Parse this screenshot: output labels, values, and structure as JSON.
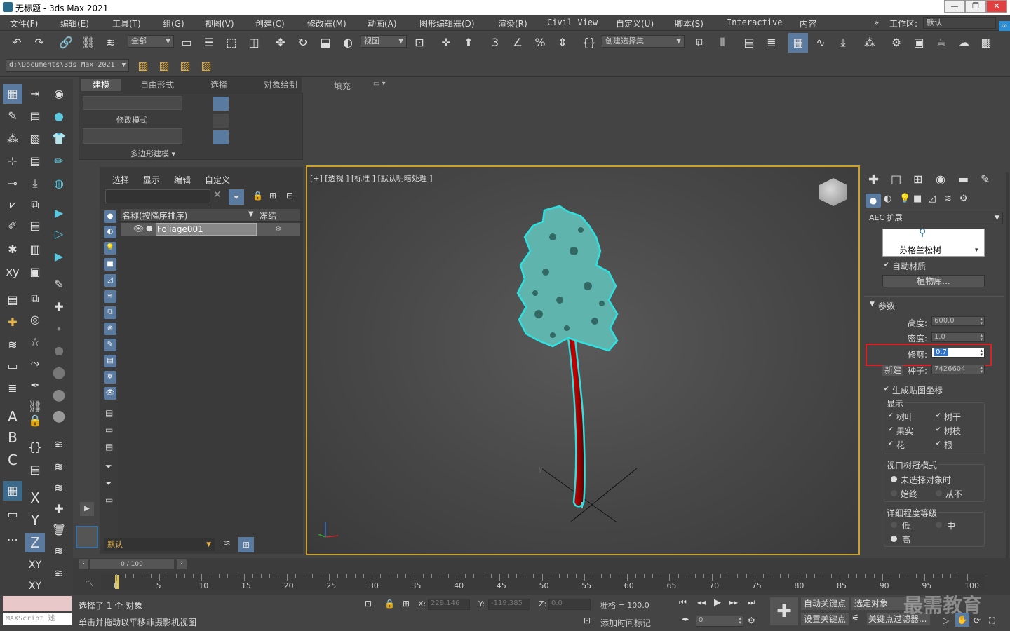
{
  "window": {
    "title": "无标题 - 3ds Max 2021",
    "controls": [
      "—",
      "❐",
      "✕"
    ]
  },
  "menu": [
    "文件(F)",
    "编辑(E)",
    "工具(T)",
    "组(G)",
    "视图(V)",
    "创建(C)",
    "修改器(M)",
    "动画(A)",
    "图形编辑器(D)",
    "渲染(R)",
    "Civil View",
    "自定义(U)",
    "脚本(S)",
    "Interactive",
    "内容"
  ],
  "workspace": {
    "label": "工作区:",
    "value": "默认"
  },
  "toolbar": {
    "selection_filter": "全部",
    "ref_coord": "视图",
    "named_sel": "创建选择集",
    "path": "d:\\Documents\\3ds Max 2021"
  },
  "ribbon": {
    "tabs": [
      "建模",
      "自由形式",
      "选择",
      "对象绘制",
      "填充"
    ],
    "modify_mode": "修改模式",
    "poly_modeling": "多边形建模 ▾"
  },
  "scene_explorer": {
    "menu": [
      "选择",
      "显示",
      "编辑",
      "自定义"
    ],
    "col_name": "名称(按降序排序)",
    "col_freeze": "冻结",
    "row": "Foliage001",
    "layer": "默认",
    "scroll": "0 / 100"
  },
  "viewport": {
    "label": "[+] [透视 ] [标准 ] [默认明暗处理 ]"
  },
  "command_panel": {
    "category": "AEC 扩展",
    "plant_name": "苏格兰松树",
    "auto_material": "自动材质",
    "plant_library": "植物库...",
    "params_title": "参数",
    "height_label": "高度:",
    "height": "600.0",
    "density_label": "密度:",
    "density": "1.0",
    "prune_label": "修剪:",
    "prune": "0.7",
    "new_label": "新建",
    "seed_label": "种子:",
    "seed": "7426604",
    "gen_map": "生成贴图坐标",
    "display_title": "显示",
    "leaves": "树叶",
    "trunk": "树干",
    "fruit": "果实",
    "branches": "树枝",
    "flowers": "花",
    "roots": "根",
    "canopy_title": "视口树冠模式",
    "canopy_unselected": "未选择对象时",
    "canopy_always": "始终",
    "canopy_never": "从不",
    "lod_title": "详细程度等级",
    "lod_low": "低",
    "lod_med": "中",
    "lod_high": "高"
  },
  "timeline": {
    "ticks": [
      "0",
      "5",
      "10",
      "15",
      "20",
      "25",
      "30",
      "35",
      "40",
      "45",
      "50",
      "55",
      "60",
      "65",
      "70",
      "75",
      "80",
      "85",
      "90",
      "95",
      "100"
    ]
  },
  "status": {
    "selected": "选择了 1 个 对象",
    "hint": "单击并拖动以平移非摄影机视图",
    "maxscript": "MAXScript 迷",
    "x_label": "X:",
    "x": "229.146",
    "y_label": "Y:",
    "y": "-119.385",
    "z_label": "Z:",
    "z": "0.0",
    "grid": "栅格 = 100.0",
    "add_tag": "添加时间标记",
    "frame": "0",
    "auto_key": "自动关键点",
    "selected_obj": "选定对象",
    "set_key": "设置关键点",
    "key_filter": "关键点过滤器...",
    "watermark": "最需教育"
  }
}
